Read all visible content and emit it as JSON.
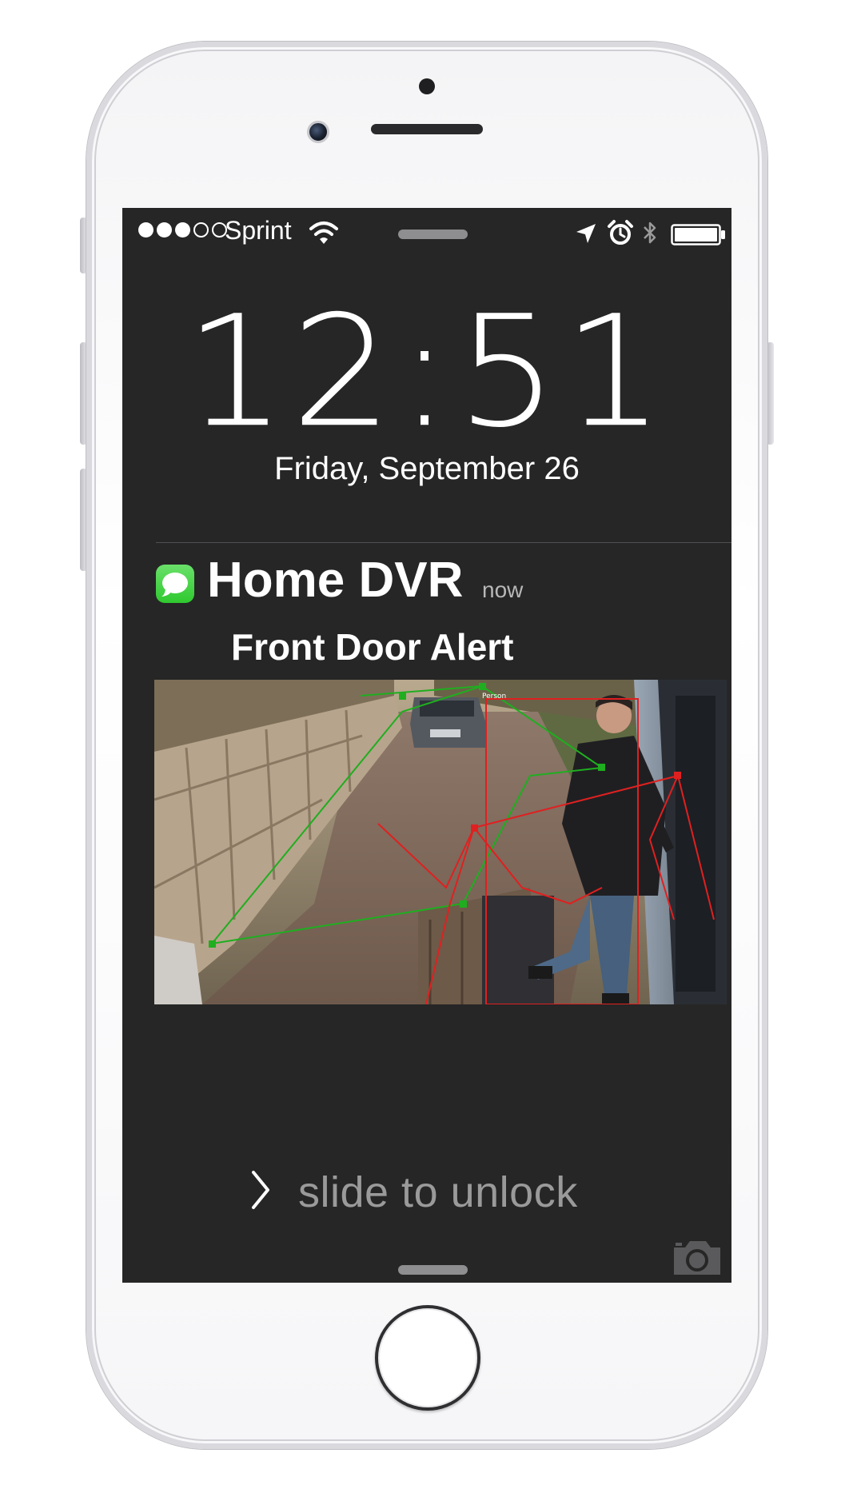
{
  "status_bar": {
    "signal_filled": 3,
    "signal_total": 5,
    "carrier": "Sprint",
    "icons": [
      "wifi-icon",
      "location-icon",
      "alarm-icon",
      "bluetooth-icon",
      "battery-icon"
    ]
  },
  "lock_screen": {
    "time": "12:51",
    "date": "Friday, September 26"
  },
  "notification": {
    "app_icon": "messages-icon",
    "app_name": "Home DVR",
    "time": "now",
    "body": "Front Door Alert",
    "image": {
      "description_tag": "Person",
      "icon": "camera-snapshot"
    }
  },
  "unlock": {
    "label": "slide to unlock",
    "icon": "chevron-right-icon"
  },
  "colors": {
    "screen_bg": "#262626",
    "messages_green": "#3dd13d",
    "detect_green": "#1fae1f",
    "detect_red": "#e02020"
  }
}
